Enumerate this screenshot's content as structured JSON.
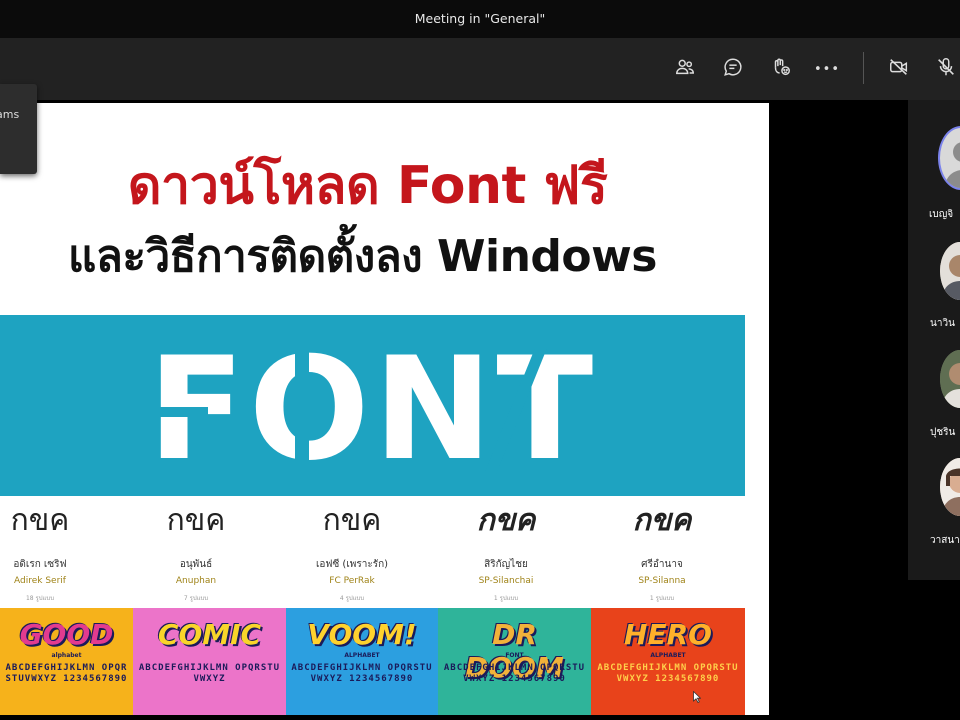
{
  "window": {
    "title": "Meeting in \"General\""
  },
  "toolbar": {
    "buttons": [
      {
        "name": "participants-icon"
      },
      {
        "name": "chat-icon"
      },
      {
        "name": "reactions-icon"
      },
      {
        "name": "more-icon",
        "label": "•••"
      },
      {
        "name": "camera-off-icon"
      },
      {
        "name": "mic-off-icon"
      }
    ]
  },
  "popup": {
    "text": "ams"
  },
  "slide": {
    "heading_red": "ดาวน์โหลด Font ฟรี",
    "heading_black": "และวิธีการติดตั้งลง Windows",
    "banner_word": "FONT",
    "samples": [
      {
        "glyph": "กขค",
        "thai": "อดิเรก เซริฟ",
        "name": "Adirek Serif",
        "count": "18 รูปแบบ"
      },
      {
        "glyph": "กขค",
        "thai": "อนุพันธ์",
        "name": "Anuphan",
        "count": "7 รูปแบบ"
      },
      {
        "glyph": "กขค",
        "thai": "เอฟซี (เพราะรัก)",
        "name": "FC PerRak",
        "count": "4 รูปแบบ"
      },
      {
        "glyph": "กขค",
        "thai": "สิริกัญไชย",
        "name": "SP-Silanchai",
        "count": "1 รูปแบบ"
      },
      {
        "glyph": "กขค",
        "thai": "ศรีอำนาจ",
        "name": "SP-Silanna",
        "count": "1 รูปแบบ"
      }
    ],
    "tiles": [
      {
        "title": "GOOD",
        "sub": "alphabet",
        "letters": "ABCDEFGHIJKLMN OPQRSTUVWXYZ 1234567890",
        "bg": "#f6b21b",
        "fg": "#e23b8f"
      },
      {
        "title": "COMIC",
        "sub": "",
        "letters": "ABCDEFGHIJKLMN OPQRSTUVWXYZ",
        "bg": "#ec74c9",
        "fg": "#f9d52a"
      },
      {
        "title": "VOOM!",
        "sub": "ALPHABET",
        "letters": "ABCDEFGHIJKLMN OPQRSTUVWXYZ 1234567890",
        "bg": "#2c9fe0",
        "fg": "#ffd22e"
      },
      {
        "title": "DR DOOM",
        "sub": "FONT",
        "letters": "ABCDEFGHIJKLMN OPQRSTUVWXYZ 1234567890",
        "bg": "#2fb49a",
        "fg": "#f2b23a"
      },
      {
        "title": "HERO",
        "sub": "ALPHABET",
        "letters": "ABCDEFGHIJKLMN OPQRSTUVWXYZ 1234567890",
        "bg": "#e8431b",
        "fg": "#ffb02a"
      }
    ]
  },
  "participants": [
    {
      "name": "เบญจิ"
    },
    {
      "name": "นาวิน"
    },
    {
      "name": "ปุชริน"
    },
    {
      "name": "วาสนา"
    }
  ]
}
